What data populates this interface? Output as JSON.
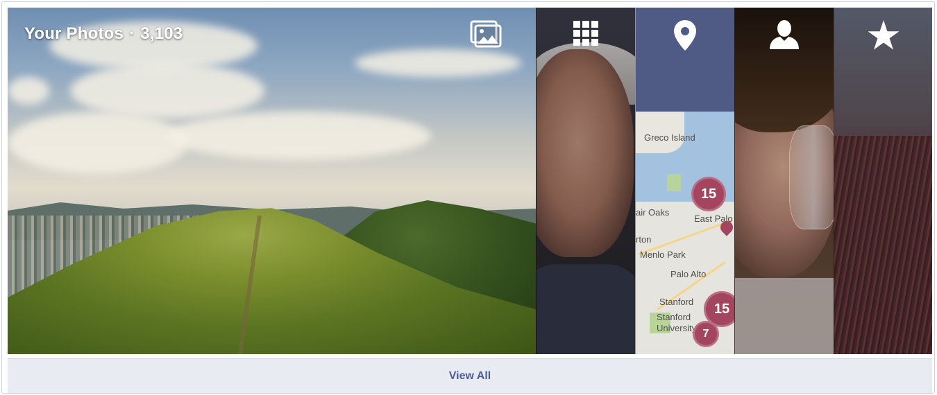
{
  "header": {
    "title": "Your Photos",
    "separator": "·",
    "count": "3,103"
  },
  "albums": [
    {
      "name": "photos",
      "icon": "photos-icon"
    },
    {
      "name": "grid",
      "icon": "grid-icon"
    },
    {
      "name": "places",
      "icon": "location-pin-icon"
    },
    {
      "name": "people",
      "icon": "person-icon"
    },
    {
      "name": "favorites",
      "icon": "star-icon"
    }
  ],
  "map": {
    "labels": [
      "Greco Island",
      "East Palo",
      "air Oaks",
      "rton",
      "Menlo Park",
      "Palo Alto",
      "Stanford",
      "Stanford University"
    ],
    "clusters": [
      "15",
      "15",
      "7"
    ],
    "cluster_color": "#a3455f"
  },
  "footer": {
    "view_all_label": "View All"
  },
  "colors": {
    "link": "#4a5d98",
    "footer_bg": "#e9ebf2"
  }
}
